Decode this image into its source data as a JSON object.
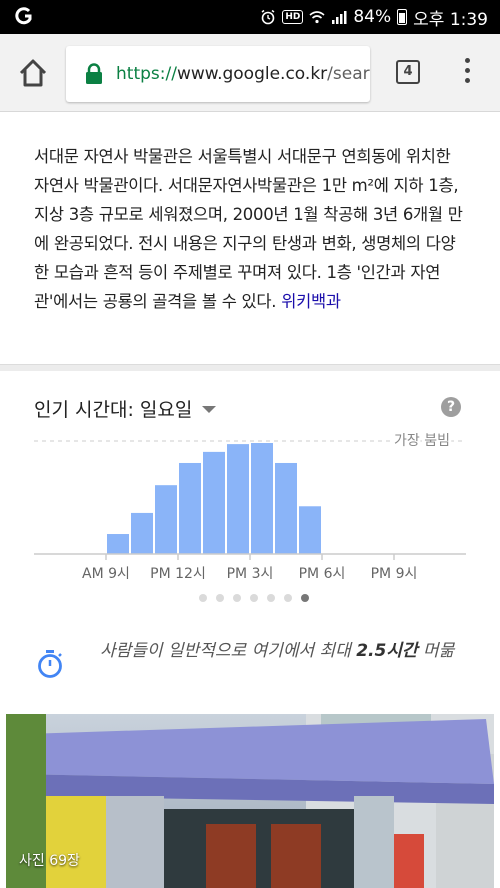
{
  "status_bar": {
    "battery": "84%",
    "time": "오후 1:39",
    "hd_label": "HD",
    "icons": [
      "g-logo-icon",
      "alarm-icon",
      "hd-icon",
      "wifi-icon",
      "signal-icon",
      "battery-icon"
    ]
  },
  "toolbar": {
    "url_scheme": "https://",
    "url_host": "www.google.co.kr",
    "url_path": "/search",
    "tab_count": "4",
    "icons": [
      "home-icon",
      "lock-icon",
      "tabs-icon",
      "overflow-menu-icon"
    ]
  },
  "description": {
    "text": "서대문 자연사 박물관은 서울특별시 서대문구 연희동에 위치한 자연사 박물관이다. 서대문자연사박물관은 1만 m²에 지하 1층, 지상 3층 규모로 세워졌으며, 2000년 1월 착공해 3년 6개월 만에 완공되었다. 전시 내용은 지구의 탄생과 변화, 생명체의 다양한 모습과 흔적 등이 주제별로 꾸며져 있다. 1층 '인간과 자연관'에서는 공룡의 골격을 볼 수 있다.",
    "source_link": "위키백과"
  },
  "popular_times": {
    "title": "인기 시간대: 일요일",
    "help_label": "?",
    "page_dots": 7,
    "active_dot": 6
  },
  "chart_data": {
    "type": "bar",
    "title": "",
    "reference_line_label": "가장 붐빔",
    "x_tick_labels": [
      {
        "hour": 9,
        "label": "AM 9시"
      },
      {
        "hour": 12,
        "label": "PM 12시"
      },
      {
        "hour": 15,
        "label": "PM 3시"
      },
      {
        "hour": 18,
        "label": "PM 6시"
      },
      {
        "hour": 21,
        "label": "PM 9시"
      }
    ],
    "hours": [
      6,
      7,
      8,
      9,
      10,
      11,
      12,
      13,
      14,
      15,
      16,
      17,
      18,
      19,
      20,
      21,
      22,
      23
    ],
    "values": [
      0,
      0,
      0,
      18,
      37,
      62,
      82,
      92,
      99,
      100,
      82,
      43,
      0,
      0,
      0,
      0,
      0,
      0
    ],
    "ylim": [
      0,
      100
    ],
    "bar_color": "#8ab4f8",
    "axis_color": "#cccccc",
    "grid": false
  },
  "visit_duration": {
    "text_before": "사람들이 일반적으로 여기에서 최대 ",
    "text_bold": "2.5시간",
    "text_after": " 머묾"
  },
  "photo": {
    "label": "사진 69장"
  },
  "colors": {
    "link": "#1a0dab",
    "secure_green": "#0b8043",
    "stopwatch_blue": "#4285f4",
    "bar_blue": "#8ab4f8"
  }
}
